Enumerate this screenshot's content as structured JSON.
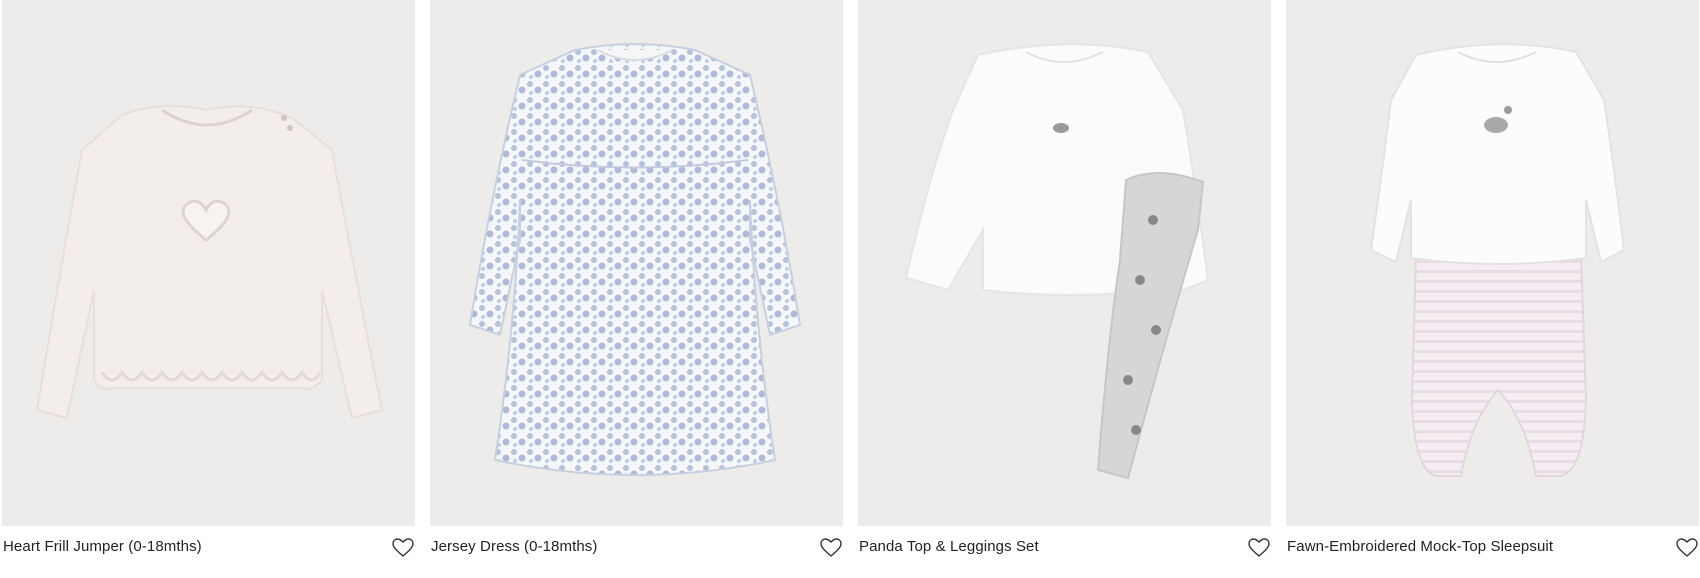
{
  "products": [
    {
      "title": "Heart Frill Jumper (0-18mths)",
      "image_icon": "heart-frill-jumper-image",
      "wishlist_icon": "heart-outline-icon"
    },
    {
      "title": "Jersey Dress (0-18mths)",
      "image_icon": "jersey-dress-image",
      "wishlist_icon": "heart-outline-icon"
    },
    {
      "title": "Panda Top & Leggings Set",
      "image_icon": "panda-top-leggings-image",
      "wishlist_icon": "heart-outline-icon"
    },
    {
      "title": "Fawn-Embroidered Mock-Top Sleepsuit",
      "image_icon": "fawn-sleepsuit-image",
      "wishlist_icon": "heart-outline-icon"
    }
  ],
  "colors": {
    "image_background": "#edecea",
    "text": "#222222"
  }
}
